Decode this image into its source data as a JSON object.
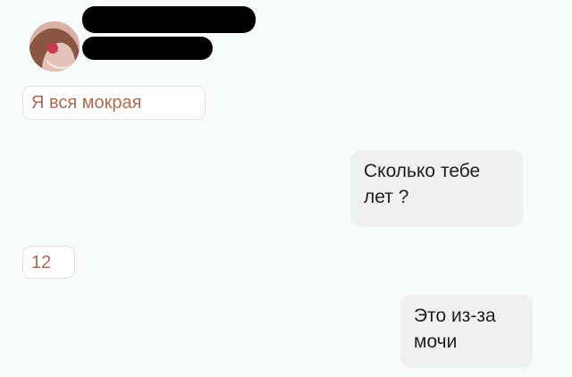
{
  "contact": {
    "avatar_icon": "profile-photo-icon"
  },
  "messages": [
    {
      "direction": "incoming",
      "text": "Я вся мокрая"
    },
    {
      "direction": "outgoing",
      "text": "Сколько тебе\nлет ?"
    },
    {
      "direction": "incoming",
      "text": "12"
    },
    {
      "direction": "outgoing",
      "text": "Это из-за\nмочи"
    }
  ],
  "colors": {
    "background": "#f8fbfb",
    "incoming_text": "#a86a55",
    "incoming_border": "#eadfdc",
    "outgoing_bubble": "#eef0f1",
    "outgoing_text": "#1f1f1f",
    "redaction": "#000000"
  }
}
